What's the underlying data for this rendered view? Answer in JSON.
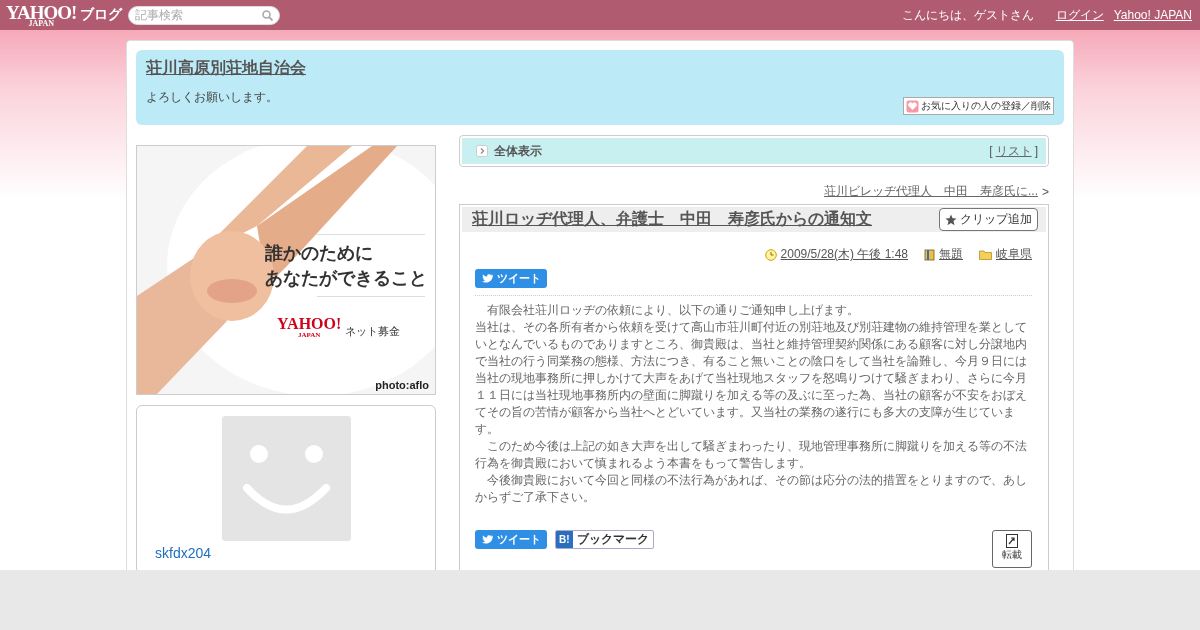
{
  "header": {
    "logo": "YAHOO!",
    "logo_sub": "JAPAN",
    "service": "ブログ",
    "search": {
      "placeholder": "記事検索"
    },
    "greeting": "こんにちは、ゲストさん",
    "links": [
      "ログイン",
      "Yahoo! JAPAN"
    ]
  },
  "blog": {
    "title": "荘川高原別荘地自治会",
    "description": "よろしくお願いします。",
    "favorite_button": "お気に入りの人の登録／削除"
  },
  "ad": {
    "kind": "picture",
    "headline": [
      "誰かのために",
      "あなたができること"
    ],
    "brand": "YAHOO!",
    "brand_sub": "JAPAN",
    "service": "ネット募金",
    "credit": "photo:aflo"
  },
  "profile": {
    "username": "skfdx204"
  },
  "view_bar": {
    "label": "全体表示",
    "open": "[",
    "list_link": "リスト",
    "close": "]"
  },
  "prev_link": {
    "text": "荘川ビレッヂ代理人　中田　寿彦氏に...",
    "marker": ">"
  },
  "article": {
    "title": "荘川ロッヂ代理人、弁護士　中田　寿彦氏からの通知文",
    "clip_button": "クリップ追加",
    "date": "2009/5/28(木) 午後 1:48",
    "theme": "無題",
    "category": "岐阜県",
    "tweet_button": "ツイート",
    "body": [
      "　有限会社荘川ロッヂの依頼により、以下の通りご通知申し上げます。",
      "当社は、その各所有者から依頼を受けて高山市荘川町付近の別荘地及び別荘建物の維持管理を業としていとなんでいるものでありますところ、御貴殿は、当社と維持管理契約関係にある顧客に対し分譲地内で当社の行う同業務の態様、方法につき、有ること無いことの陰口をして当社を論難し、今月９日には当社の現地事務所に押しかけて大声をあげて当社現地スタッフを怒鳴りつけて騒ぎまわり、さらに今月１１日には当社現地事務所内の壁面に脚蹴りを加える等の及ぶに至った為、当社の顧客が不安をおぼえてその旨の苦情が顧客から当社へとどいています。又当社の業務の遂行にも多大の支障が生じています。",
      "　このため今後は上記の如き大声を出して騒ぎまわったり、現地管理事務所に脚蹴りを加える等の不法行為を御貴殿において慎まれるよう本書をもって警告します。",
      "　今後御貴殿において今回と同様の不法行為があれば、その節は応分の法的措置をとりますので、あしからずご了承下さい。"
    ],
    "share_buttons": [
      {
        "kind": "tweet",
        "label": "ツイート"
      },
      {
        "kind": "bookmark",
        "icon_text": "B!",
        "label": "ブックマーク"
      }
    ],
    "repost_button": "転載"
  }
}
